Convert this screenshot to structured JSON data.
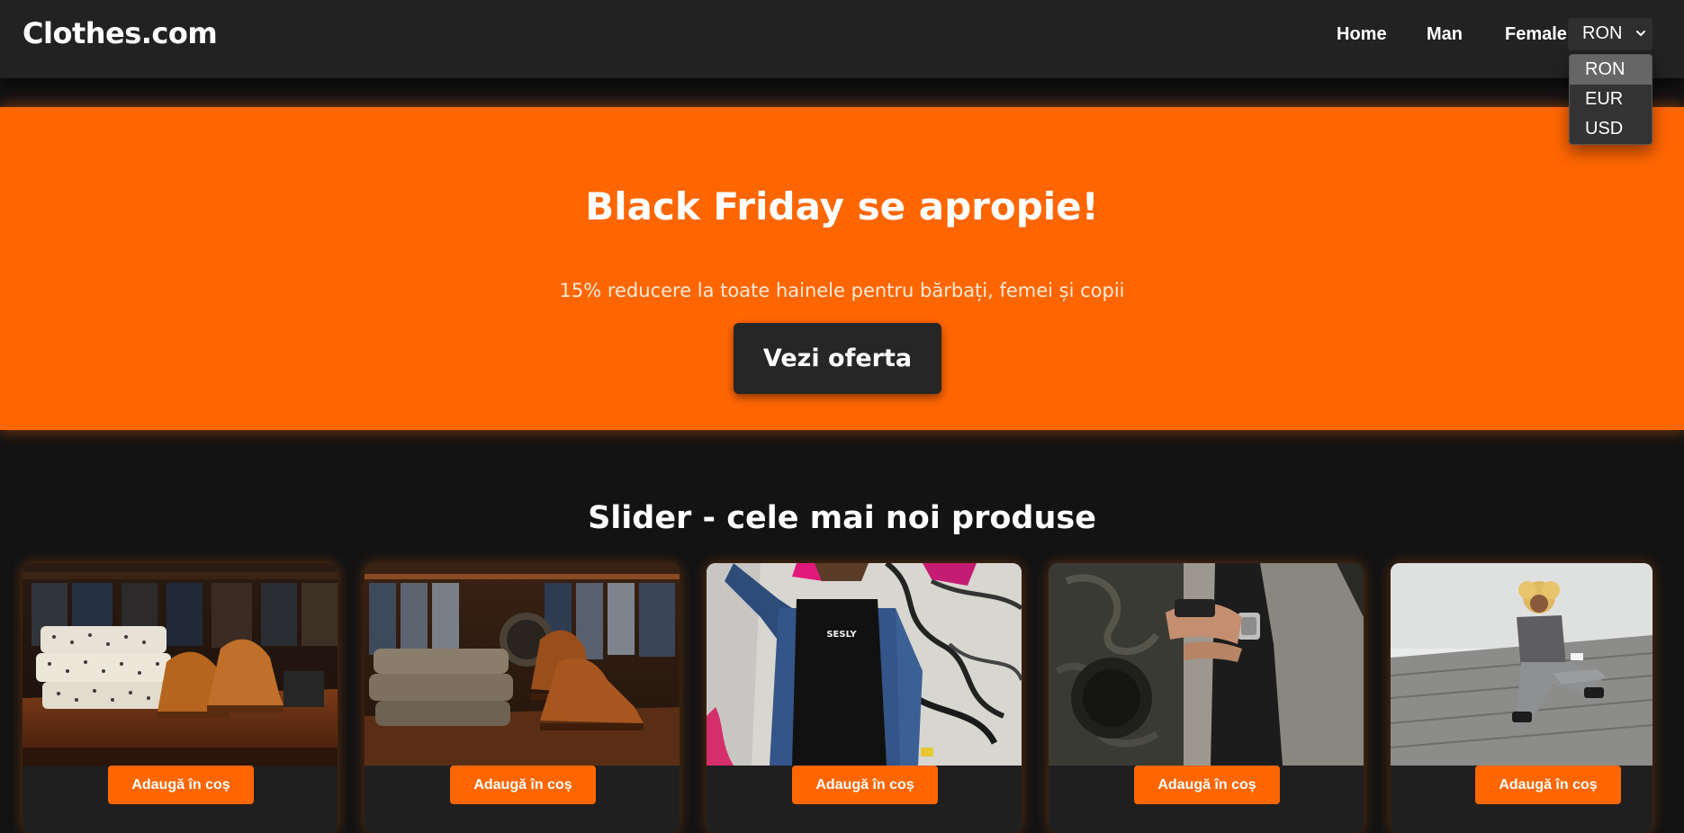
{
  "header": {
    "logo": "Clothes.com",
    "nav": [
      "Home",
      "Man",
      "Female"
    ],
    "currency": {
      "selected": "RON",
      "options": [
        "RON",
        "EUR",
        "USD"
      ]
    }
  },
  "hero": {
    "title": "Black Friday se apropie!",
    "subtitle": "15% reducere la toate hainele pentru bărbați, femei și copii",
    "cta": "Vezi oferta"
  },
  "slider": {
    "title": "Slider - cele mai noi produse",
    "products": [
      {
        "button": "Adaugă în coș",
        "image": "shoes-and-shirts-photo"
      },
      {
        "button": "Adaugă în coș",
        "image": "brogues-and-folded-clothes-photo"
      },
      {
        "button": "Adaugă în coș",
        "image": "man-denim-jacket-graffiti-photo",
        "tshirt_text": "SESLY"
      },
      {
        "button": "Adaugă în coș",
        "image": "man-checking-phone-photo"
      },
      {
        "button": "Adaugă în coș",
        "image": "man-sitting-on-floor-photo"
      }
    ]
  },
  "colors": {
    "accent": "#ff6600",
    "header_bg": "#222222",
    "page_bg": "#131313",
    "cta_bg": "#262626"
  }
}
